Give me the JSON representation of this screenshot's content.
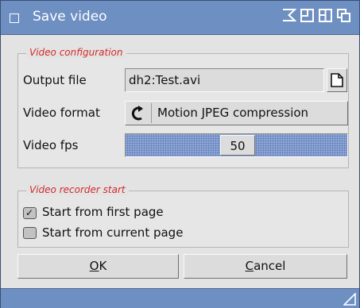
{
  "window": {
    "title": "Save video"
  },
  "video_config": {
    "group_label": "Video configuration",
    "output_file_label": "Output file",
    "output_file_value": "dh2:Test.avi",
    "video_format_label": "Video format",
    "video_format_value": "Motion JPEG compression",
    "video_fps_label": "Video fps",
    "video_fps_value": "50"
  },
  "recorder_start": {
    "group_label": "Video recorder start",
    "options": [
      {
        "label": "Start from first page",
        "checked": true
      },
      {
        "label": "Start from current page",
        "checked": false
      }
    ]
  },
  "buttons": {
    "ok_underline": "O",
    "ok_rest": "K",
    "cancel_underline": "C",
    "cancel_rest": "ancel"
  },
  "colors": {
    "titlebar": "#6e8fc2",
    "group_label": "#d42a2a",
    "slider": "#6f8bc3"
  },
  "checkmark_glyph": "✓"
}
